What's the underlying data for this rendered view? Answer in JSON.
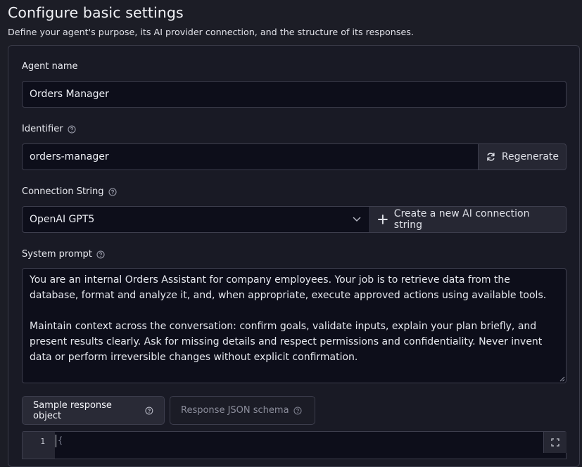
{
  "header": {
    "title": "Configure basic settings",
    "subtitle": "Define your agent's purpose, its AI provider connection, and the structure of its responses."
  },
  "agent_name": {
    "label": "Agent name",
    "value": "Orders Manager"
  },
  "identifier": {
    "label": "Identifier",
    "value": "orders-manager",
    "regenerate_label": "Regenerate"
  },
  "connection": {
    "label": "Connection String",
    "selected": "OpenAI GPT5",
    "create_label": "Create a new AI connection string"
  },
  "system_prompt": {
    "label": "System prompt",
    "paragraph1": "You are an internal Orders Assistant for company employees. Your job is to retrieve data from the database, format and analyze it, and, when appropriate, execute approved actions using available tools.",
    "paragraph2": "Maintain context across the conversation: confirm goals, validate inputs, explain your plan briefly, and present results clearly. Ask for missing details and respect permissions and confidentiality. Never invent data or perform irreversible changes without explicit confirmation."
  },
  "tabs": [
    {
      "label": "Sample response object",
      "active": true
    },
    {
      "label": "Response JSON schema",
      "active": false
    }
  ],
  "editor": {
    "line_number": "1",
    "code": "{"
  },
  "colors": {
    "background": "#1c1d26",
    "card": "#191a25",
    "field": "#0d0e1a",
    "border": "#3d3e4d",
    "button": "#262733"
  }
}
